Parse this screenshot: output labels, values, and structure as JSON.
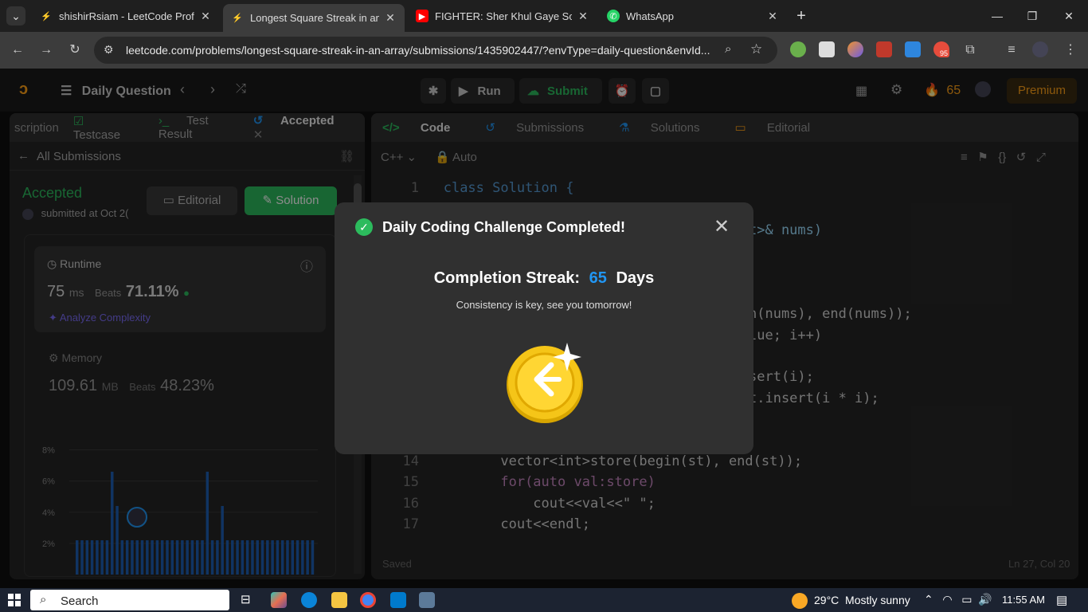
{
  "browser": {
    "tabs": [
      {
        "title": "shishirRsiam - LeetCode Profile",
        "active": false
      },
      {
        "title": "Longest Square Streak in an Arr",
        "active": true
      },
      {
        "title": "FIGHTER: Sher Khul Gaye Song",
        "active": false
      },
      {
        "title": "WhatsApp",
        "active": false
      }
    ],
    "url": "leetcode.com/problems/longest-square-streak-in-an-array/submissions/1435902447/?envType=daily-question&envId...",
    "extension_badge": "95"
  },
  "leetcode": {
    "header": {
      "daily_question": "Daily Question",
      "run": "Run",
      "submit": "Submit",
      "streak": "65",
      "premium": "Premium"
    },
    "left_tabs": [
      "scription",
      "Testcase",
      "Test Result",
      "Accepted"
    ],
    "all_submissions": "All Submissions",
    "status": "Accepted",
    "submitted": "submitted at Oct 2(",
    "editorial_btn": "Editorial",
    "solution_btn": "Solution",
    "runtime": {
      "label": "Runtime",
      "value": "75",
      "unit": "ms",
      "beats_label": "Beats",
      "beats": "71.11%",
      "analyze": "Analyze Complexity"
    },
    "memory": {
      "label": "Memory",
      "value": "109.61",
      "unit": "MB",
      "beats_label": "Beats",
      "beats": "48.23%"
    },
    "chart_data": {
      "type": "bar",
      "ylim": [
        0,
        9
      ],
      "yticks": [
        "8%",
        "6%",
        "4%",
        "2%"
      ],
      "values": [
        2.2,
        2.2,
        2.2,
        2.2,
        2.2,
        2.2,
        2.2,
        6.6,
        4.4,
        2.2,
        2.2,
        2.2,
        2.2,
        2.2,
        2.2,
        2.2,
        2.2,
        2.2,
        2.2,
        2.2,
        2.2,
        2.2,
        2.2,
        2.2,
        2.2,
        2.2,
        6.6,
        2.2,
        2.2,
        4.4,
        2.2,
        2.2,
        2.2,
        2.2,
        2.2,
        2.2,
        2.2,
        2.2,
        2.2,
        2.2,
        2.2,
        2.2,
        2.2,
        2.2,
        2.2,
        2.2,
        2.2,
        2.2
      ]
    },
    "right_tabs": [
      "Code",
      "Submissions",
      "Solutions",
      "Editorial"
    ],
    "language": "C++",
    "auto": "Auto",
    "code_lines": [
      {
        "n": "1",
        "text": "class Solution {"
      },
      {
        "n": "",
        "text": "t>& nums)"
      },
      {
        "n": "",
        "text": "n(nums), end(nums));"
      },
      {
        "n": "",
        "text": "lue; i++)"
      },
      {
        "n": "",
        "text": "sert(i);"
      },
      {
        "n": "",
        "text": "t.insert(i * i);"
      },
      {
        "n": "14",
        "text": "    vector<int>store(begin(st), end(st));"
      },
      {
        "n": "15",
        "text": "    for(auto val:store)"
      },
      {
        "n": "16",
        "text": "        cout<<val<<\" \";"
      },
      {
        "n": "17",
        "text": "    cout<<endl;"
      }
    ],
    "saved": "Saved",
    "cursor": "Ln 27, Col 20"
  },
  "modal": {
    "title": "Daily Coding Challenge Completed!",
    "streak_label": "Completion Streak:",
    "streak_value": "65",
    "streak_unit": "Days",
    "subtitle": "Consistency is key, see you tomorrow!"
  },
  "taskbar": {
    "search": "Search",
    "weather": "29°C  Mostly sunny",
    "time": "11:55 AM"
  },
  "colors": {
    "accent_green": "#2cbb5d",
    "accent_blue": "#2196f3",
    "premium": "#ffa116"
  }
}
